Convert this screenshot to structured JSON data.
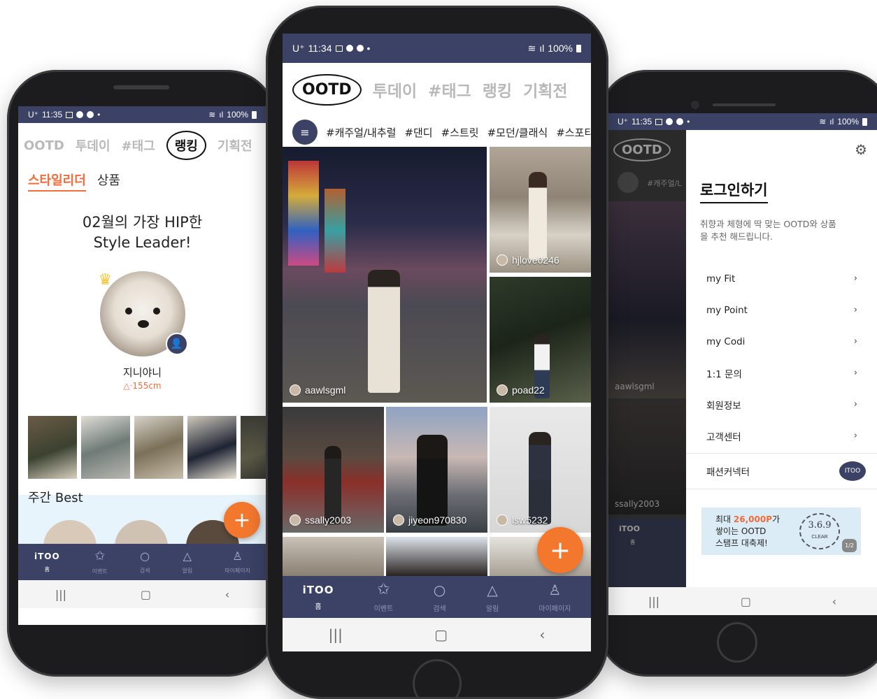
{
  "left": {
    "status": {
      "carrier": "U⁺",
      "time": "11:35",
      "battery": "100%"
    },
    "tabs": [
      {
        "label": "OOTD",
        "active": false
      },
      {
        "label": "투데이",
        "active": false
      },
      {
        "label": "#태그",
        "active": false
      },
      {
        "label": "랭킹",
        "active": true
      },
      {
        "label": "기획전",
        "active": false
      }
    ],
    "subtabs": [
      {
        "label": "스타일리더",
        "active": true
      },
      {
        "label": "상품",
        "active": false
      }
    ],
    "headline_line1": "02월의 가장 HIP한",
    "headline_line2": "Style Leader!",
    "leader_name": "지니야니",
    "leader_info": "△·155cm",
    "weekly_title": "주간 Best",
    "fab_label": "+"
  },
  "center": {
    "status": {
      "carrier": "U⁺",
      "time": "11:34",
      "battery": "100%"
    },
    "tabs": [
      {
        "label": "OOTD",
        "active": true
      },
      {
        "label": "투데이",
        "active": false
      },
      {
        "label": "#태그",
        "active": false
      },
      {
        "label": "랭킹",
        "active": false
      },
      {
        "label": "기획전",
        "active": false
      }
    ],
    "hashtags": [
      "#캐주얼/내추럴",
      "#댄디",
      "#스트릿",
      "#모던/클래식",
      "#스포티"
    ],
    "posts": [
      {
        "user": "aawlsgml"
      },
      {
        "user": "hjlove0246"
      },
      {
        "user": "poad22"
      },
      {
        "user": "ssally2003"
      },
      {
        "user": "jiyeon970830"
      },
      {
        "user": "lsw5232"
      }
    ],
    "fab_label": "+"
  },
  "nav": {
    "logo": "iTOO",
    "home": "홈",
    "event": "이벤트",
    "search": "검색",
    "alarm": "알림",
    "mypage": "마이페이지"
  },
  "right": {
    "status": {
      "carrier": "U⁺",
      "time": "11:35",
      "battery": "100%"
    },
    "behind_tab": "OOTD",
    "behind_hashtag": "#캐주얼/L",
    "behind_user_1": "aawlsgml",
    "behind_user_2": "ssally2003",
    "behind_logo": "iTOO",
    "behind_home": "홈",
    "login_title": "로그인하기",
    "login_desc": "취향과 체형에 딱 맞는 OOTD와 상품을 추천 해드립니다.",
    "menu": [
      {
        "label": "my Fit"
      },
      {
        "label": "my Point"
      },
      {
        "label": "my Codi"
      },
      {
        "label": "1:1 문의"
      },
      {
        "label": "회원정보"
      },
      {
        "label": "고객센터"
      }
    ],
    "connector_label": "패션커넥터",
    "connector_badge": "ITOO",
    "banner_pre": "최대 ",
    "banner_amount": "26,000P",
    "banner_post": "가",
    "banner_line2": "쌓이는 OOTD",
    "banner_line3": "스탬프 대축제!",
    "stamp_main": "3.6.9",
    "stamp_sub": "CLEAR",
    "banner_page": "1/2"
  },
  "colors": {
    "navy": "#3b4265",
    "orange": "#f4772e",
    "accent_text": "#f26b3a"
  }
}
